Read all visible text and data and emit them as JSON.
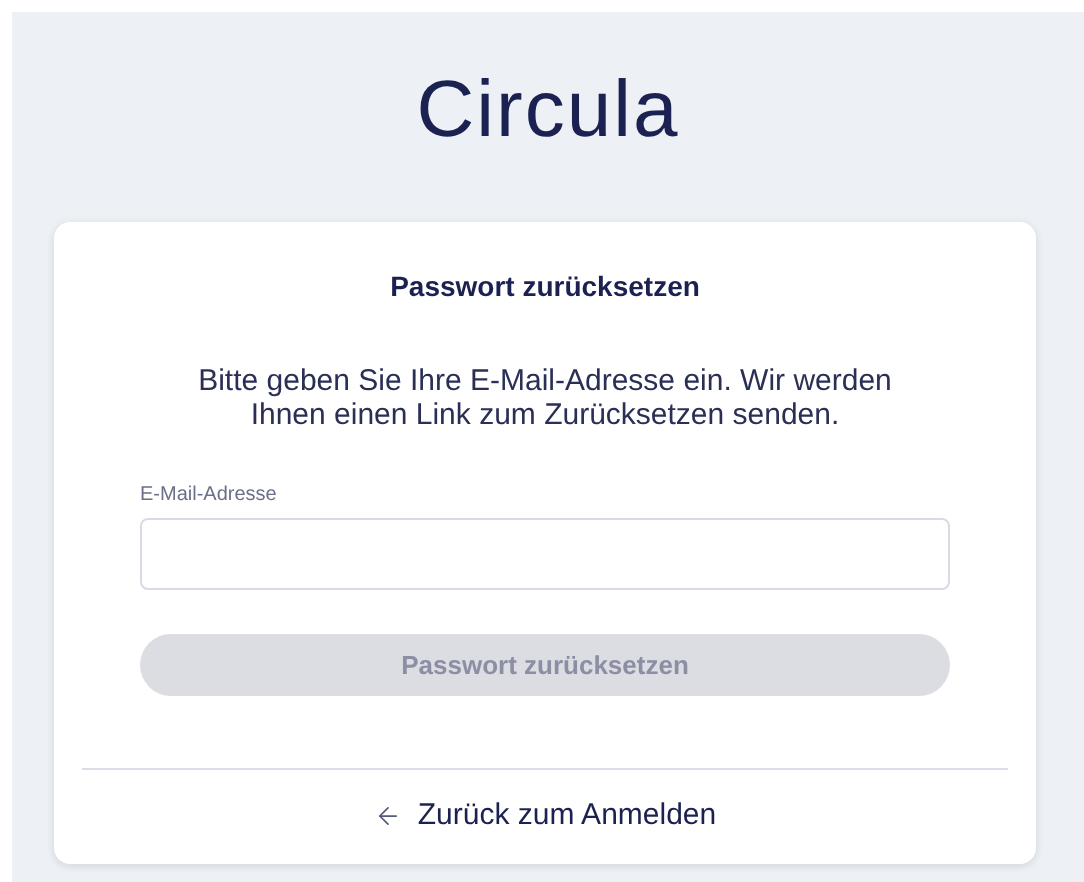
{
  "logo": "Circula",
  "card": {
    "title": "Passwort zurücksetzen",
    "description": "Bitte geben Sie Ihre E-Mail-Adresse ein. Wir werden Ihnen einen Link zum Zurücksetzen senden.",
    "email_field": {
      "label": "E-Mail-Adresse"
    },
    "submit_button": {
      "label": "Passwort zurücksetzen",
      "disabled": true
    },
    "back_link": {
      "label": "Zurück zum Anmelden"
    }
  }
}
